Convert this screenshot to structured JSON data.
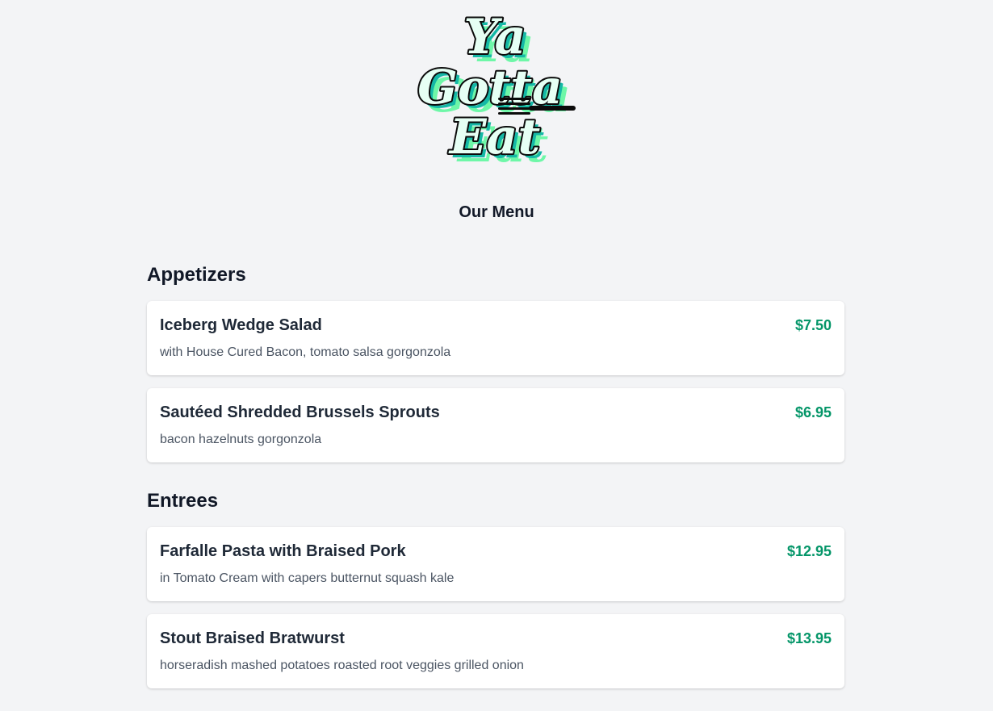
{
  "logo": {
    "text_lines": [
      "Ya",
      "Gotta",
      "Eat"
    ],
    "icon": "fork-icon",
    "colors": {
      "fill": "#e6fff4",
      "outline": "#0b0b0b",
      "shadow_teal": "#15b8a6",
      "shadow_green": "#6ef7a8"
    }
  },
  "page_title": "Our Menu",
  "sections": [
    {
      "title": "Appetizers",
      "items": [
        {
          "name": "Iceberg Wedge Salad",
          "price": "$7.50",
          "description": "with House Cured Bacon, tomato salsa gorgonzola"
        },
        {
          "name": "Sautéed Shredded Brussels Sprouts",
          "price": "$6.95",
          "description": "bacon hazelnuts gorgonzola"
        }
      ]
    },
    {
      "title": "Entrees",
      "items": [
        {
          "name": "Farfalle Pasta with Braised Pork",
          "price": "$12.95",
          "description": "in Tomato Cream with capers butternut squash kale"
        },
        {
          "name": "Stout Braised Bratwurst",
          "price": "$13.95",
          "description": "horseradish mashed potatoes roasted root veggies grilled onion"
        }
      ]
    }
  ],
  "colors": {
    "background": "#f3f4f6",
    "price": "#059669",
    "card": "#ffffff"
  }
}
